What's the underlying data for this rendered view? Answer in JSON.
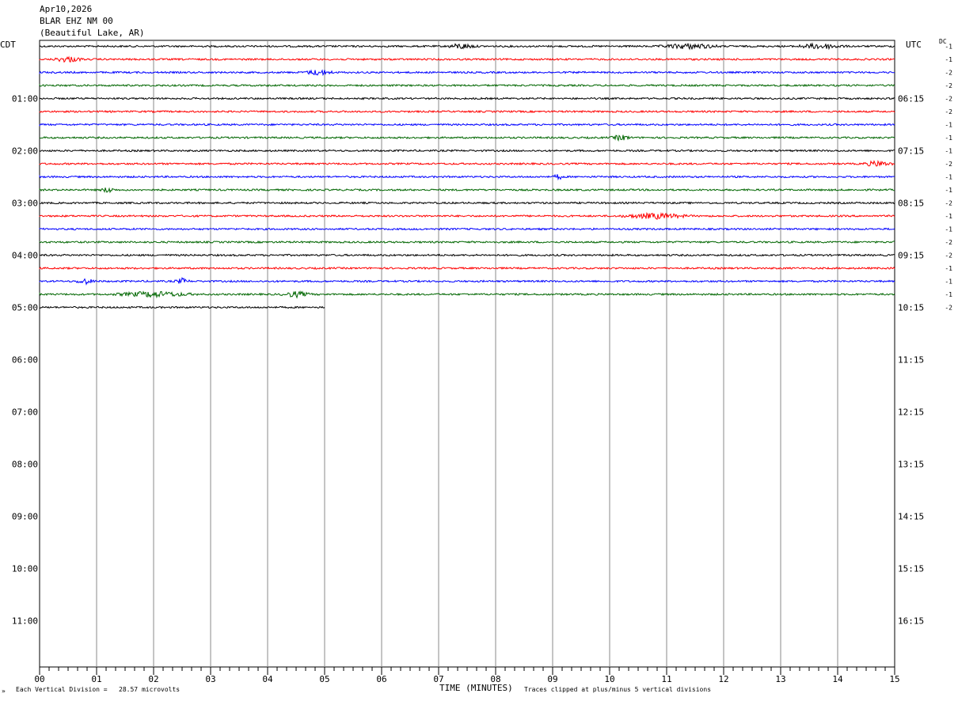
{
  "header": {
    "date": "Apr10,2026",
    "station": "BLAR EHZ NM 00",
    "location": "(Beautiful Lake, AR)"
  },
  "left_tz": "CDT",
  "right_tz": "UTC",
  "dc_label": "DC",
  "footer": {
    "scale_note": "Each Vertical Division =   28.57 microvolts",
    "clip_note": "Traces clipped at plus/minus 5 vertical divisions",
    "corner_mark": "»"
  },
  "chart_data": {
    "type": "line",
    "title": "",
    "xlabel": "TIME (MINUTES)",
    "ylabel": "",
    "xlim": [
      0,
      15
    ],
    "x_ticks": [
      "00",
      "01",
      "02",
      "03",
      "04",
      "05",
      "06",
      "07",
      "08",
      "09",
      "10",
      "11",
      "12",
      "13",
      "14",
      "15"
    ],
    "left_hour_labels": [
      "01:00",
      "02:00",
      "03:00",
      "04:00",
      "05:00",
      "06:00",
      "07:00",
      "08:00",
      "09:00",
      "10:00",
      "11:00"
    ],
    "right_hour_labels": [
      "06:15",
      "07:15",
      "08:15",
      "09:15",
      "10:15",
      "11:15",
      "12:15",
      "13:15",
      "14:15",
      "15:15",
      "16:15"
    ],
    "rows_per_hour": 4,
    "total_rows": 48,
    "trace_colors": [
      "#000000",
      "#ff0000",
      "#0000ff",
      "#006600"
    ],
    "trace_rows": [
      {
        "row": 0,
        "color": "#000000",
        "end_minute": 15,
        "dc": "-1",
        "bursts": [
          [
            7.4,
            0.6
          ],
          [
            11.4,
            1.2
          ],
          [
            13.7,
            1.0
          ]
        ]
      },
      {
        "row": 1,
        "color": "#ff0000",
        "end_minute": 15,
        "dc": "-1",
        "bursts": [
          [
            0.5,
            0.6
          ]
        ]
      },
      {
        "row": 2,
        "color": "#0000ff",
        "end_minute": 15,
        "dc": "-2",
        "bursts": [
          [
            4.9,
            0.6
          ]
        ]
      },
      {
        "row": 3,
        "color": "#006600",
        "end_minute": 15,
        "dc": "-2",
        "bursts": []
      },
      {
        "row": 4,
        "color": "#000000",
        "end_minute": 15,
        "dc": "-2",
        "bursts": []
      },
      {
        "row": 5,
        "color": "#ff0000",
        "end_minute": 15,
        "dc": "-2",
        "bursts": []
      },
      {
        "row": 6,
        "color": "#0000ff",
        "end_minute": 15,
        "dc": "-1",
        "bursts": []
      },
      {
        "row": 7,
        "color": "#006600",
        "end_minute": 15,
        "dc": "-1",
        "bursts": [
          [
            10.2,
            0.4
          ]
        ]
      },
      {
        "row": 8,
        "color": "#000000",
        "end_minute": 15,
        "dc": "-1",
        "bursts": []
      },
      {
        "row": 9,
        "color": "#ff0000",
        "end_minute": 15,
        "dc": "-2",
        "bursts": [
          [
            14.7,
            0.6
          ]
        ]
      },
      {
        "row": 10,
        "color": "#0000ff",
        "end_minute": 15,
        "dc": "-1",
        "bursts": [
          [
            9.1,
            0.2
          ]
        ]
      },
      {
        "row": 11,
        "color": "#006600",
        "end_minute": 15,
        "dc": "-1",
        "bursts": [
          [
            1.2,
            0.3
          ]
        ]
      },
      {
        "row": 12,
        "color": "#000000",
        "end_minute": 15,
        "dc": "-2",
        "bursts": []
      },
      {
        "row": 13,
        "color": "#ff0000",
        "end_minute": 15,
        "dc": "-1",
        "bursts": [
          [
            10.8,
            1.4
          ]
        ]
      },
      {
        "row": 14,
        "color": "#0000ff",
        "end_minute": 15,
        "dc": "-1",
        "bursts": []
      },
      {
        "row": 15,
        "color": "#006600",
        "end_minute": 15,
        "dc": "-2",
        "bursts": []
      },
      {
        "row": 16,
        "color": "#000000",
        "end_minute": 15,
        "dc": "-2",
        "bursts": []
      },
      {
        "row": 17,
        "color": "#ff0000",
        "end_minute": 15,
        "dc": "-1",
        "bursts": []
      },
      {
        "row": 18,
        "color": "#0000ff",
        "end_minute": 15,
        "dc": "-1",
        "bursts": [
          [
            0.8,
            0.4
          ],
          [
            2.5,
            0.3
          ]
        ]
      },
      {
        "row": 19,
        "color": "#006600",
        "end_minute": 15,
        "dc": "-1",
        "bursts": [
          [
            2.0,
            1.6
          ],
          [
            4.5,
            0.6
          ]
        ]
      },
      {
        "row": 20,
        "color": "#000000",
        "end_minute": 5,
        "dc": "-2",
        "bursts": []
      }
    ]
  }
}
